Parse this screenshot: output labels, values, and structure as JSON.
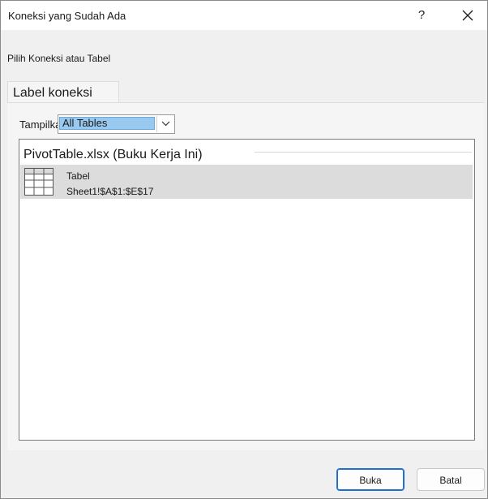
{
  "window": {
    "title": "Koneksi yang Sudah Ada",
    "help_label": "?"
  },
  "instruction": "Pilih Koneksi atau Tabel",
  "tabs": [
    {
      "label": "Label koneksi",
      "selected": true
    }
  ],
  "filter": {
    "label": "Tampilkan:",
    "selected_value": "All Tables"
  },
  "list": {
    "group_title": "PivotTable.xlsx (Buku Kerja Ini)",
    "items": [
      {
        "icon": "table-grid-icon",
        "name": "Tabel",
        "range": "Sheet1!$A$1:$E$17",
        "selected": true
      }
    ]
  },
  "buttons": {
    "open": "Buka",
    "cancel": "Batal"
  }
}
